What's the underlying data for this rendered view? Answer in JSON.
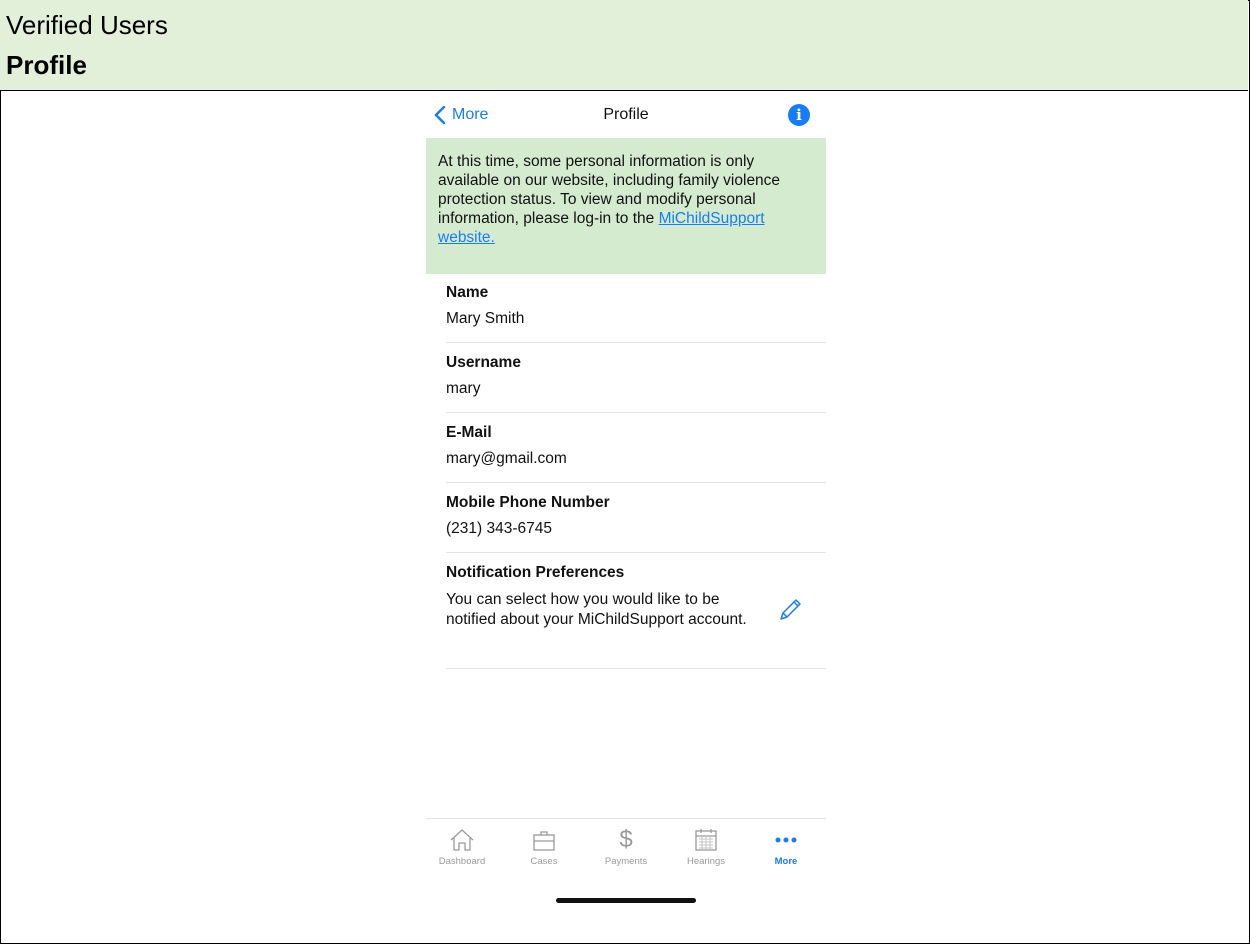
{
  "doc": {
    "line1": "Verified Users",
    "line2": "Profile"
  },
  "nav": {
    "back_label": "More",
    "title": "Profile",
    "info_icon": "info-icon"
  },
  "notice": {
    "text": "At this time, some personal information is only available on our website, including family violence protection status. To view and modify personal information, please log-in to the ",
    "link": "MiChildSupport website."
  },
  "fields": [
    {
      "label": "Name",
      "value": "Mary Smith"
    },
    {
      "label": "Username",
      "value": "mary"
    },
    {
      "label": "E-Mail",
      "value": "mary@gmail.com"
    },
    {
      "label": "Mobile Phone Number",
      "value": "(231) 343-6745"
    }
  ],
  "prefs": {
    "label": "Notification Preferences",
    "text": "You can select how you would like to be notified about your MiChildSupport account.",
    "edit_icon": "pencil-icon"
  },
  "tabs": [
    {
      "label": "Dashboard",
      "icon": "home-icon"
    },
    {
      "label": "Cases",
      "icon": "briefcase-icon"
    },
    {
      "label": "Payments",
      "icon": "dollar-icon"
    },
    {
      "label": "Hearings",
      "icon": "calendar-icon"
    },
    {
      "label": "More",
      "icon": "more-icon",
      "active": true
    }
  ],
  "colors": {
    "accent": "#1a7cf5",
    "notice_bg": "#d5ebd0",
    "header_bg": "#e2efd9"
  }
}
